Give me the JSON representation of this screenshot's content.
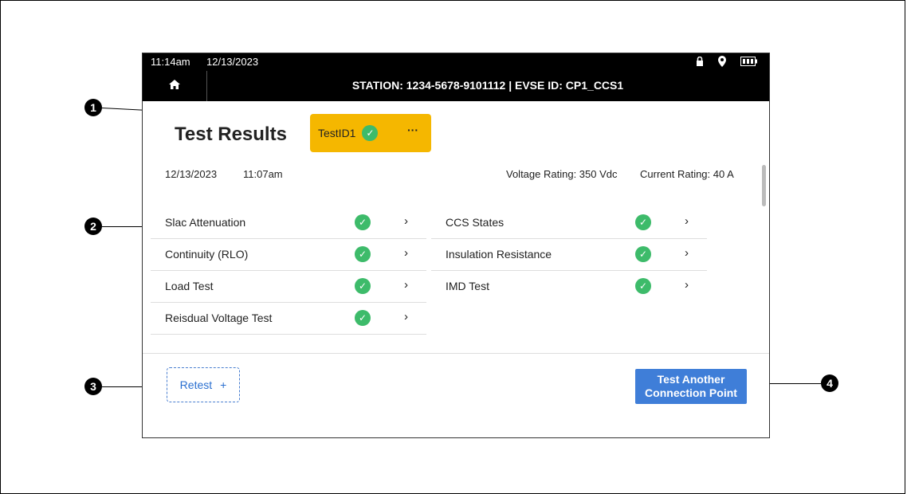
{
  "status_bar": {
    "time": "11:14am",
    "date": "12/13/2023",
    "icons": [
      "lock-icon",
      "location-pin-icon",
      "battery-icon"
    ]
  },
  "nav": {
    "station_label": "STATION: 1234-5678-9101112 | EVSE ID: CP1_CCS1"
  },
  "page": {
    "title": "Test Results",
    "test_id_label": "TestID1",
    "test_date": "12/13/2023",
    "test_time": "11:07am",
    "voltage_rating": "Voltage Rating: 350 Vdc",
    "current_rating": "Current Rating: 40 A"
  },
  "tests_left": [
    {
      "label": "Slac Attenuation"
    },
    {
      "label": "Continuity (RLO)"
    },
    {
      "label": "Load Test"
    },
    {
      "label": "Reisdual Voltage Test"
    }
  ],
  "tests_right": [
    {
      "label": "CCS States"
    },
    {
      "label": "Insulation Resistance"
    },
    {
      "label": "IMD Test"
    }
  ],
  "buttons": {
    "retest": "Retest",
    "test_another": "Test Another Connection Point"
  },
  "callouts": [
    "1",
    "2",
    "3",
    "4"
  ],
  "colors": {
    "accent_yellow": "#f5b700",
    "check_green": "#3dbb6a",
    "primary_blue": "#3f7ed8"
  }
}
